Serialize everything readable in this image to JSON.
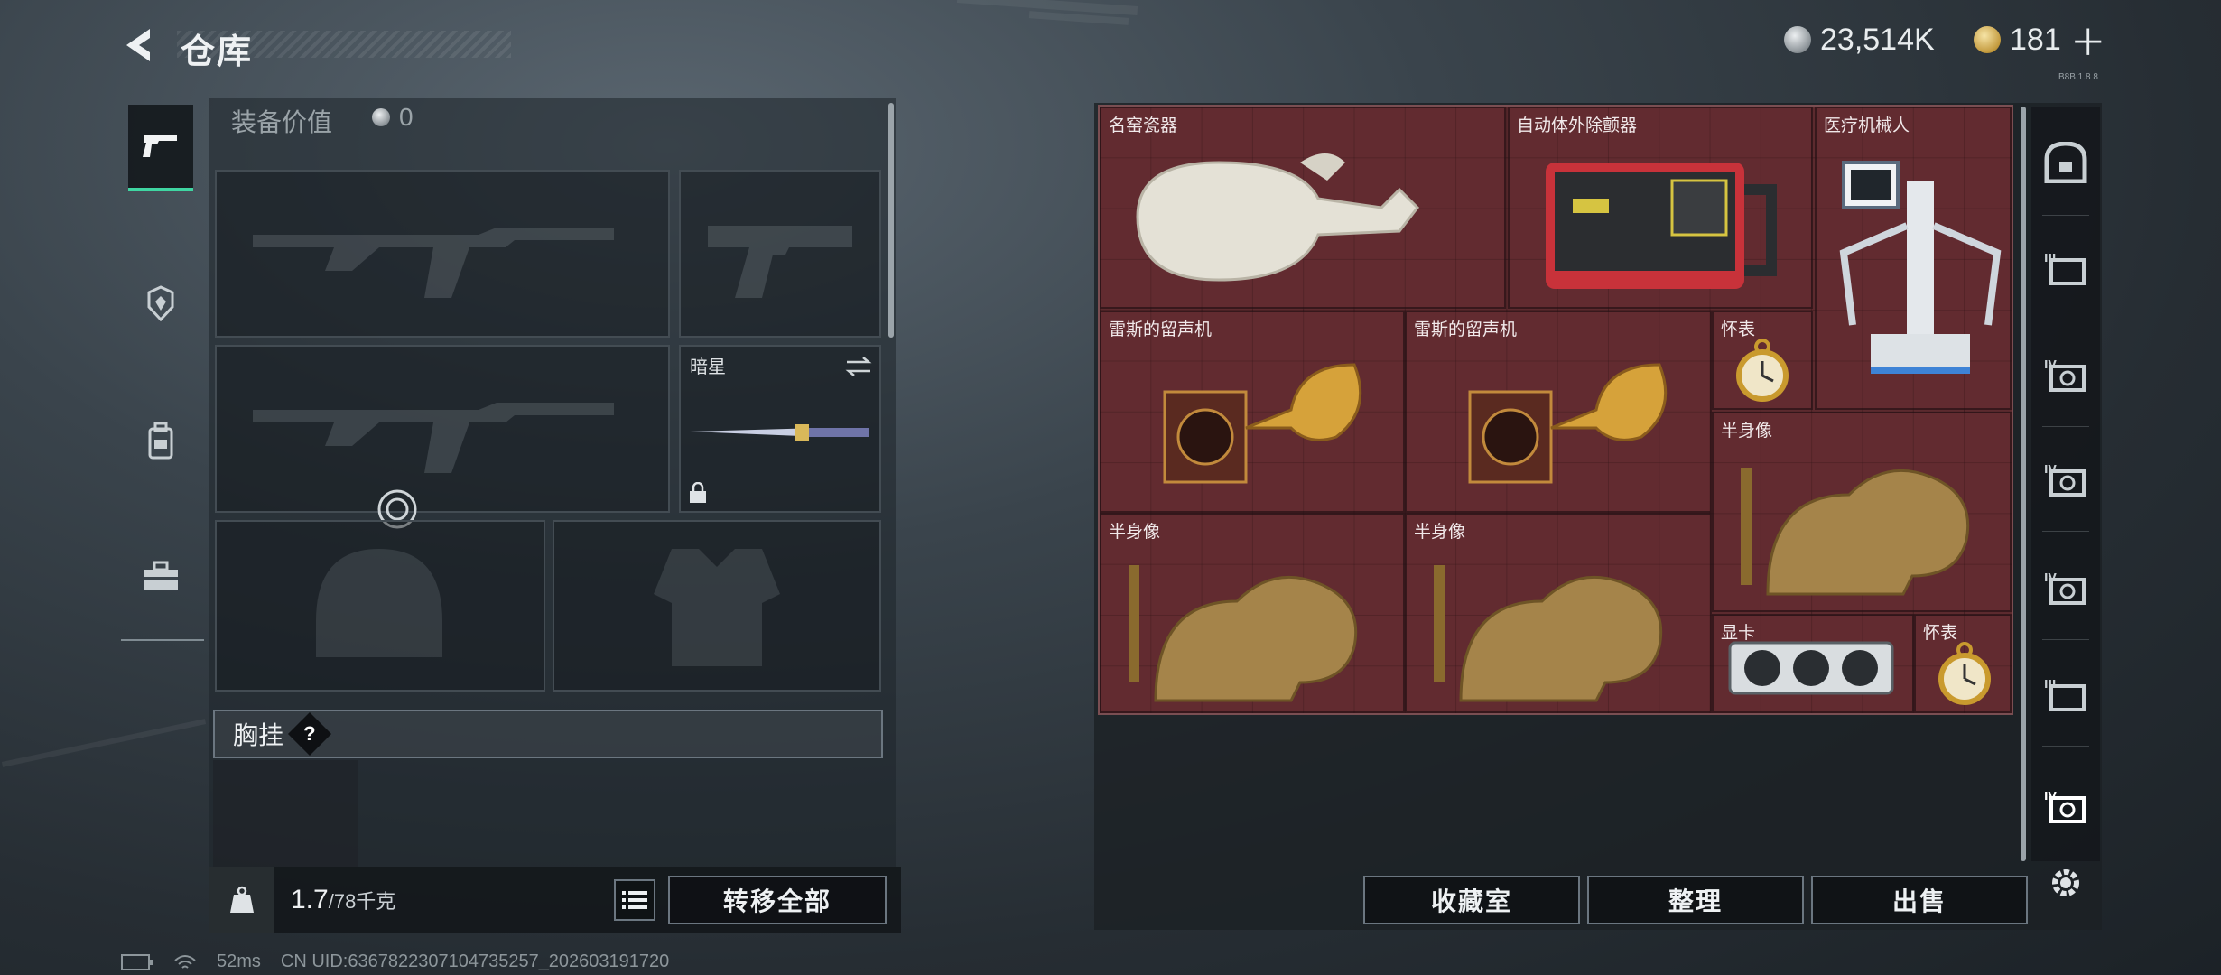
{
  "header": {
    "title": "仓库",
    "currency_silver": "23,514K",
    "currency_gold": "181",
    "plus_symbol": "＋",
    "corner_code": "B8B 1.8 8"
  },
  "equipment": {
    "value_label": "装备价值",
    "value_amount": "0",
    "melee_slot_name": "暗星",
    "chest_rig_label": "胸挂",
    "help_symbol": "?",
    "weight_current": "1.7",
    "weight_capacity": "/78千克",
    "transfer_all_label": "转移全部"
  },
  "stash": {
    "items": [
      {
        "name": "名窑瓷器"
      },
      {
        "name": "自动体外除颤器"
      },
      {
        "name": "医疗机械人"
      },
      {
        "name": "雷斯的留声机"
      },
      {
        "name": "雷斯的留声机"
      },
      {
        "name": "怀表"
      },
      {
        "name": "半身像"
      },
      {
        "name": "半身像"
      },
      {
        "name": "半身像"
      },
      {
        "name": "显卡"
      },
      {
        "name": "怀表"
      }
    ],
    "buttons": {
      "collection": "收藏室",
      "sort": "整理",
      "sell": "出售"
    }
  },
  "status_bar": {
    "ping": "52ms",
    "uid": "CN UID:6367822307104735257_202603191720"
  },
  "colors": {
    "accent": "#3fd6a2",
    "stash_bg": "#5c2a2e"
  },
  "icons": {
    "back": "back-arrow-icon",
    "weapon_tab": "pistol-icon",
    "armor_tab": "armor-badge-icon",
    "backpack_tab": "backpack-icon",
    "toolkit_tab": "toolbox-icon",
    "settings": "gear-icon"
  }
}
